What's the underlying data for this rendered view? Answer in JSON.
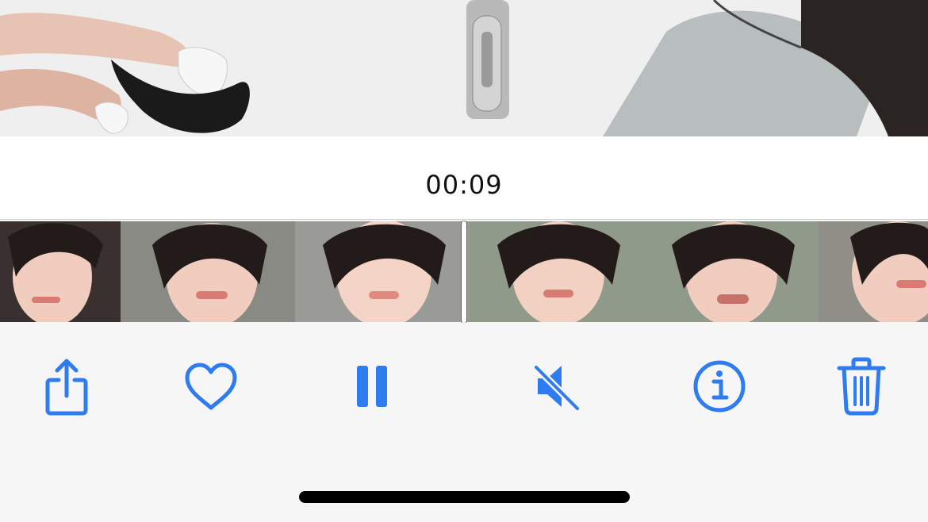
{
  "viewer": {
    "playback_time": "00:09",
    "frame_count": 6
  },
  "toolbar": {
    "buttons": [
      {
        "name": "share-button",
        "icon": "share-icon"
      },
      {
        "name": "favorite-button",
        "icon": "heart-icon"
      },
      {
        "name": "pause-button",
        "icon": "pause-icon"
      },
      {
        "name": "mute-button",
        "icon": "speaker-muted-icon"
      },
      {
        "name": "info-button",
        "icon": "info-icon"
      },
      {
        "name": "delete-button",
        "icon": "trash-icon"
      }
    ]
  },
  "colors": {
    "accent": "#2f7cf0",
    "background": "#f6f6f6",
    "home_indicator": "#000000"
  }
}
